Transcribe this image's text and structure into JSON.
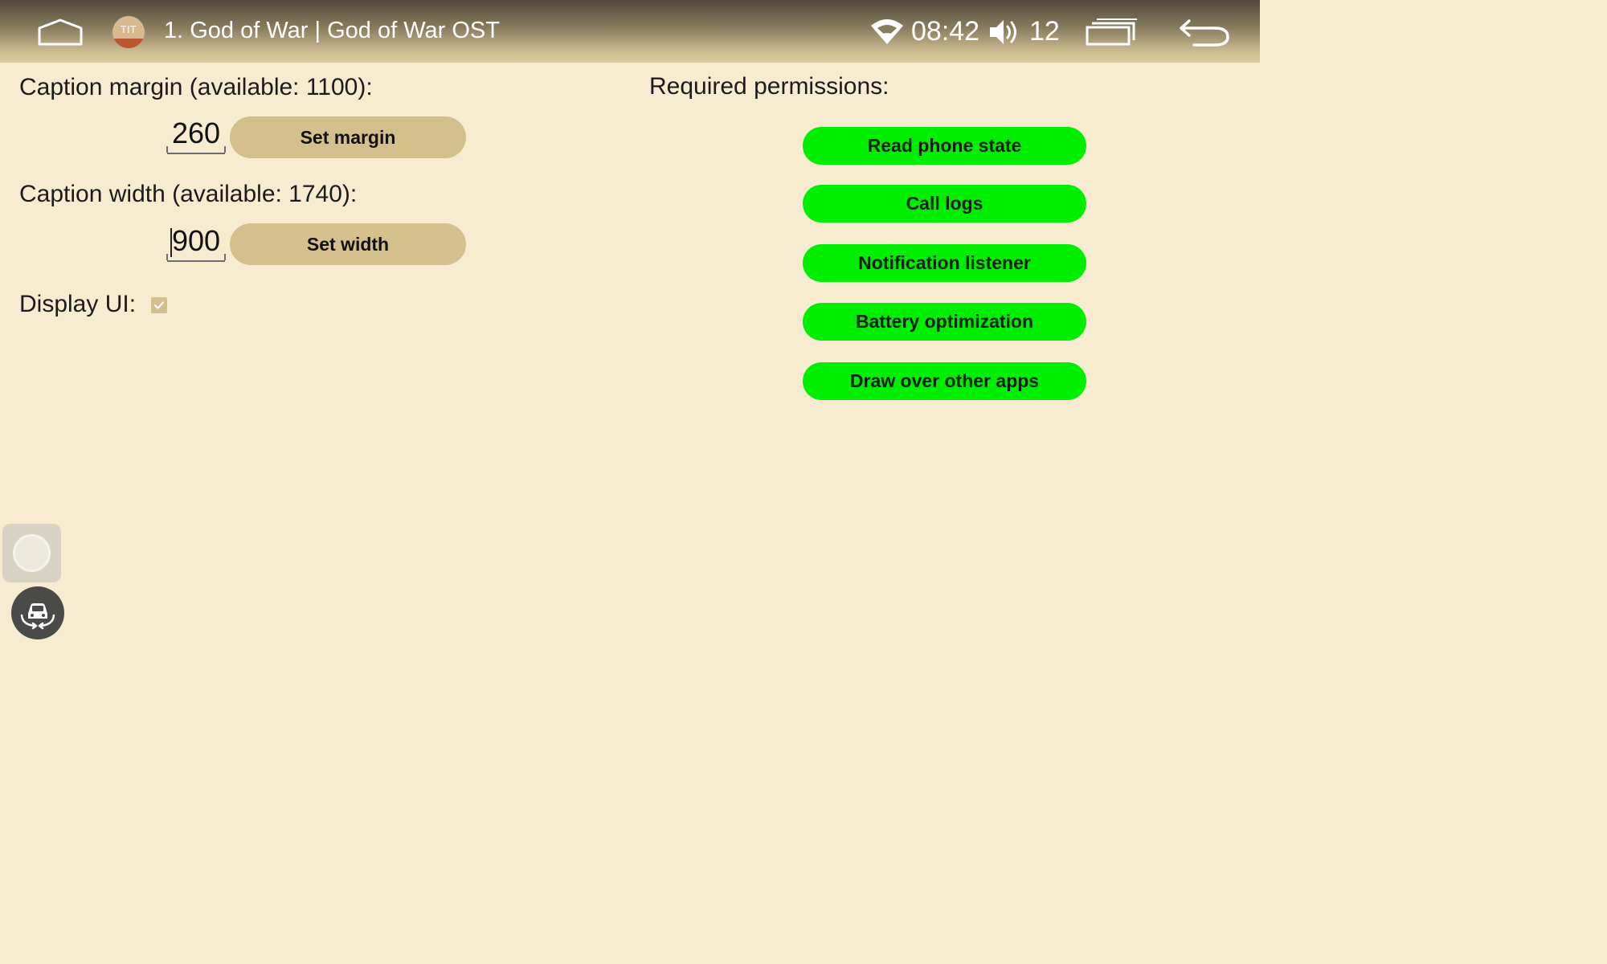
{
  "status_bar": {
    "now_playing": "1. God of War | God of War OST",
    "app_badge_text": "TIT",
    "time": "08:42",
    "volume": "12"
  },
  "settings": {
    "caption_margin_label": "Caption margin (available: 1100):",
    "caption_margin_value": "260",
    "set_margin_label": "Set margin",
    "caption_width_label": "Caption width (available: 1740):",
    "caption_width_value": "900",
    "set_width_label": "Set width",
    "display_ui_label": "Display UI:",
    "display_ui_checked": true
  },
  "permissions": {
    "title": "Required permissions:",
    "buttons": [
      "Read phone state",
      "Call logs",
      "Notification listener",
      "Battery optimization",
      "Draw over other apps"
    ],
    "button_color": "#00ee00"
  },
  "colors": {
    "background": "#f7ecd0",
    "accent": "#d4c08c"
  },
  "floating_widgets": {
    "assistive_touch_icon": "circle-icon",
    "car_icon": "car-360-icon"
  }
}
